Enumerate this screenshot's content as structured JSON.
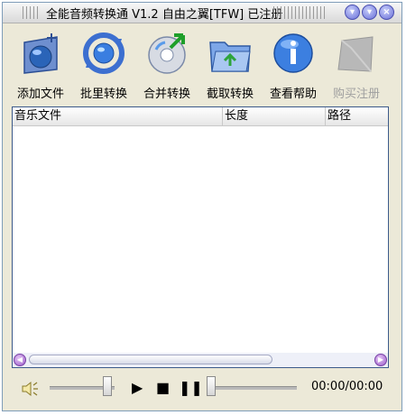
{
  "window": {
    "title": "全能音频转换通 V1.2 自由之翼[TFW] 已注册",
    "buttons": [
      "minimize",
      "restore",
      "close"
    ]
  },
  "toolbar": {
    "items": [
      {
        "label": "添加文件",
        "icon": "add-file-icon",
        "enabled": true
      },
      {
        "label": "批里转换",
        "icon": "batch-convert-icon",
        "enabled": true
      },
      {
        "label": "合并转换",
        "icon": "merge-convert-icon",
        "enabled": true
      },
      {
        "label": "截取转换",
        "icon": "cut-convert-icon",
        "enabled": true
      },
      {
        "label": "查看帮助",
        "icon": "help-icon",
        "enabled": true
      },
      {
        "label": "购买注册",
        "icon": "buy-register-icon",
        "enabled": false
      }
    ]
  },
  "list": {
    "columns": [
      "音乐文件",
      "长度",
      "路径"
    ],
    "rows": []
  },
  "player": {
    "time": "00:00/00:00",
    "volume_level": 0.95,
    "position_level": 0.0
  }
}
